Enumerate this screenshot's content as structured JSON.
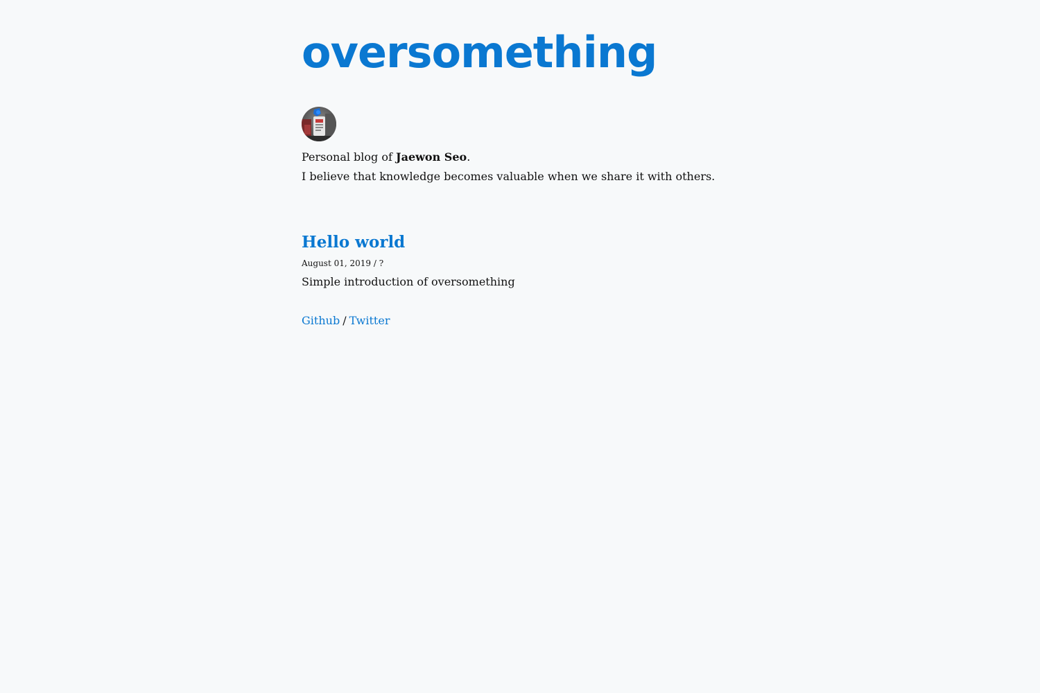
{
  "site": {
    "title": "oversomething",
    "accent_color": "#0a78d1",
    "background_color": "#f7f9fa"
  },
  "bio": {
    "avatar_icon": "author-photo-avatar",
    "intro_prefix": "Personal blog of ",
    "author_name": "Jaewon Seo",
    "intro_suffix": ".",
    "tagline": "I believe that knowledge becomes valuable when we share it with others."
  },
  "posts": [
    {
      "title": "Hello world",
      "date": "August 01, 2019",
      "meta_separator": " / ",
      "reading_marker": "?",
      "excerpt": "Simple introduction of oversomething"
    }
  ],
  "footer": {
    "links": [
      {
        "label": "Github"
      },
      {
        "label": "Twitter"
      }
    ],
    "separator": "/"
  }
}
